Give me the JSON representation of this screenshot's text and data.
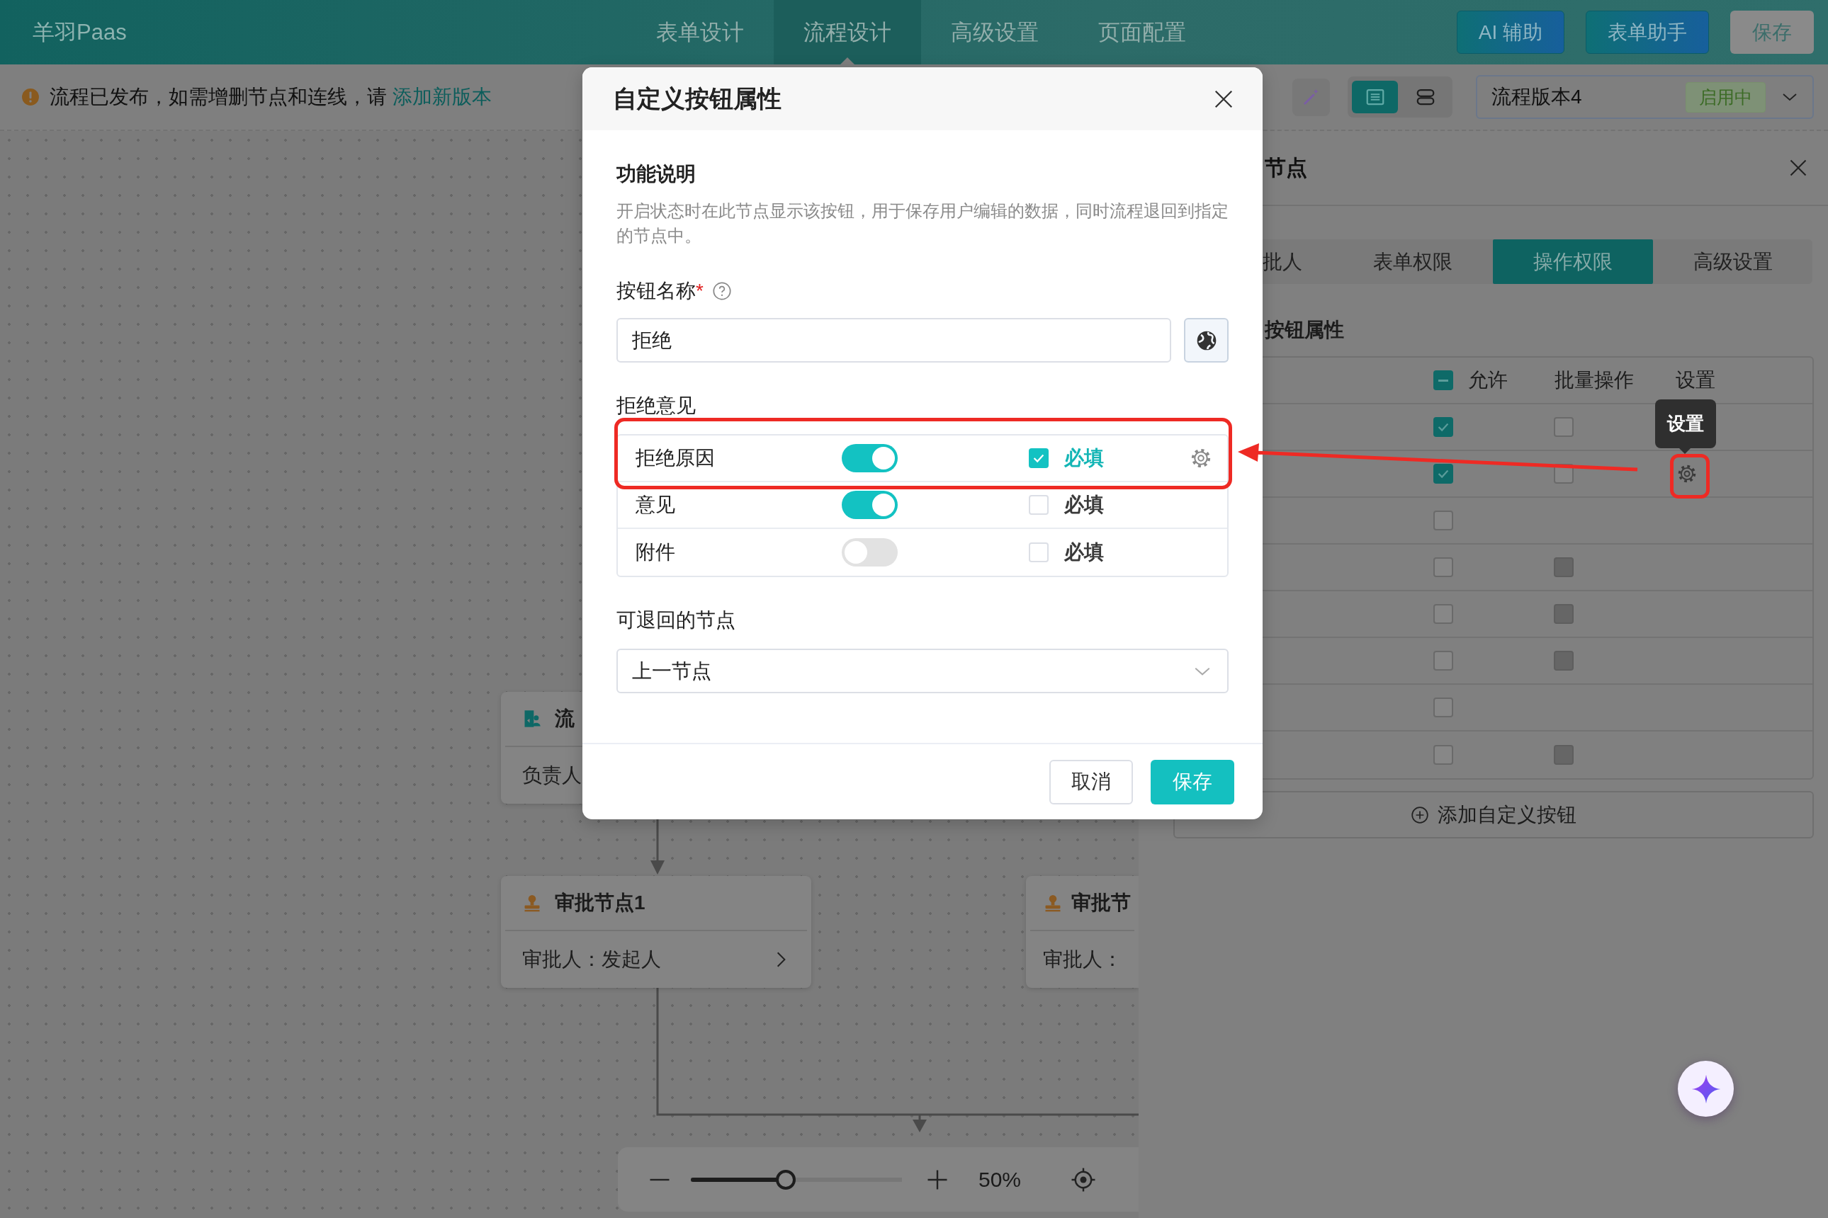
{
  "top_bar": {
    "logo": "羊羽Paas",
    "nav": [
      {
        "label": "表单设计",
        "selected": false
      },
      {
        "label": "流程设计",
        "selected": true
      },
      {
        "label": "高级设置",
        "selected": false
      },
      {
        "label": "页面配置",
        "selected": false
      }
    ],
    "buttons": [
      {
        "label": "AI 辅助",
        "kind": "assistant"
      },
      {
        "label": "表单助手",
        "kind": "assistant"
      },
      {
        "label": "保存",
        "kind": "plain"
      }
    ]
  },
  "notice": {
    "text": "流程已发布，如需增删节点和连线，请",
    "link": "添加新版本"
  },
  "toolbar": {
    "views": [
      {
        "kind": "list",
        "selected": true
      },
      {
        "kind": "stack",
        "selected": false
      }
    ],
    "version": {
      "value": "流程版本4",
      "badge": "启用中"
    }
  },
  "canvas": {
    "nodes": [
      {
        "kind": "process",
        "title": "流",
        "line": "负责人"
      },
      {
        "kind": "approval",
        "title": "审批节点1",
        "line": "审批人：发起人",
        "expandable": true
      },
      {
        "kind": "approval",
        "title": "审批节",
        "line": "审批人："
      }
    ],
    "zoom": {
      "level": 0.45,
      "reading": "50%"
    }
  },
  "panel": {
    "title": "节点",
    "tabs": [
      {
        "label": "批人",
        "selected": false
      },
      {
        "label": "表单权限",
        "selected": false
      },
      {
        "label": "操作权限",
        "selected": true
      },
      {
        "label": "高级设置",
        "selected": false
      }
    ],
    "section": "按钮属性",
    "columns": [
      "允许",
      "批量操作",
      "设置"
    ],
    "select_all_indeterminate": true,
    "rows": [
      {
        "allowed": true,
        "batch_checked": false,
        "batch_disabled": false,
        "settings": false
      },
      {
        "allowed": true,
        "batch_checked": false,
        "batch_disabled": false,
        "settings": true
      },
      {
        "allowed": false,
        "settings": false
      },
      {
        "allowed": false,
        "batch_disabled": true,
        "settings": false
      },
      {
        "allowed": false,
        "batch_disabled": true,
        "settings": false
      },
      {
        "allowed": false,
        "batch_disabled": true,
        "settings": false
      },
      {
        "allowed": false,
        "settings": false
      },
      {
        "allowed": false,
        "batch_disabled": true,
        "settings": false
      }
    ],
    "tooltip": "设置",
    "add_button": "添加自定义按钮"
  },
  "dialog": {
    "title": "自定义按钮属性",
    "description_heading": "功能说明",
    "description": "开启状态时在此节点显示该按钮，用于保存用户编辑的数据，同时流程退回到指定的节点中。",
    "name_label": "按钮名称",
    "required_mark": "*",
    "name_value": "拒绝",
    "opinion_label": "拒绝意见",
    "opinions": [
      {
        "label": "拒绝原因",
        "on": true,
        "required": true,
        "required_label": "必填",
        "settings": true
      },
      {
        "label": "意见",
        "on": true,
        "required": false,
        "required_label": "必填",
        "settings": false
      },
      {
        "label": "附件",
        "on": false,
        "required": false,
        "required_label": "必填",
        "settings": false
      }
    ],
    "return_label": "可退回的节点",
    "return_value": "上一节点",
    "buttons": [
      {
        "label": "取消",
        "kind": "secondary"
      },
      {
        "label": "保存",
        "kind": "primary"
      }
    ]
  }
}
